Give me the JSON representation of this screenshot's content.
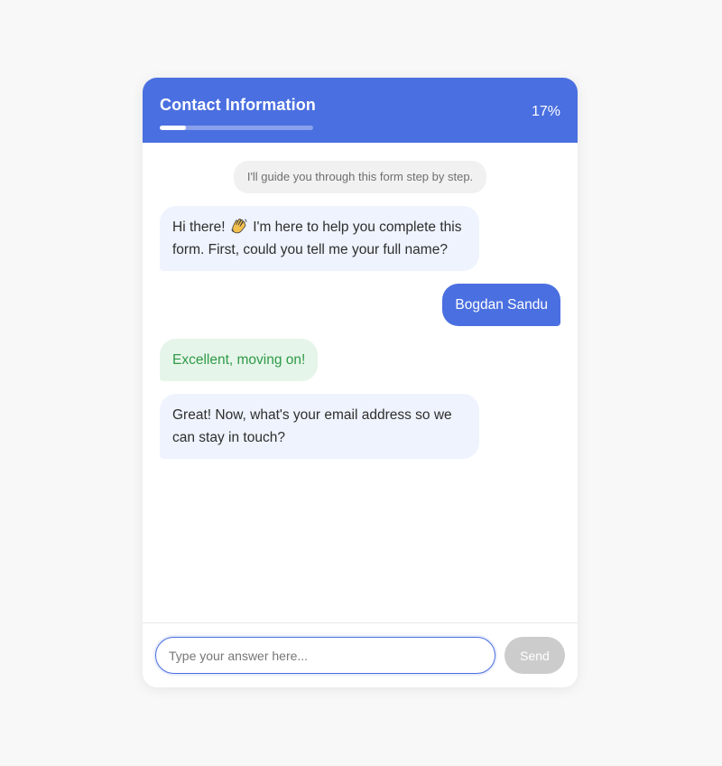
{
  "header": {
    "title": "Contact Information",
    "progress_percent": 17,
    "progress_text": "17%"
  },
  "messages": {
    "system_note": "I'll guide you through this form step by step.",
    "bot_greeting_before_emoji": "Hi there! ",
    "bot_greeting_emoji": "waving-hand-icon",
    "bot_greeting_after_emoji": " I'm here to help you complete this form. First, could you tell me your full name?",
    "user_reply": "Bogdan Sandu",
    "success_text": "Excellent, moving on!",
    "bot_question": "Great! Now, what's your email address so we can stay in touch?"
  },
  "composer": {
    "placeholder": "Type your answer here...",
    "value": "",
    "send_label": "Send"
  },
  "colors": {
    "accent": "#4a6fe0",
    "bot_bubble": "#eef3fd",
    "success_bg": "#e6f5e9",
    "success_text": "#2e9a47",
    "send_disabled": "#cccccc"
  }
}
